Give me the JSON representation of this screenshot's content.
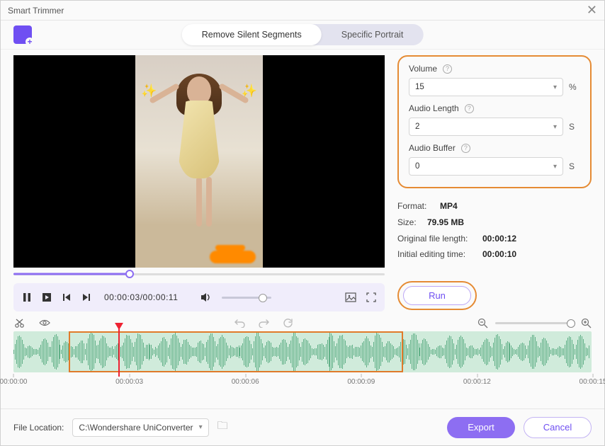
{
  "window": {
    "title": "Smart Trimmer"
  },
  "tabs": {
    "remove_silent": "Remove Silent Segments",
    "specific_portrait": "Specific Portrait"
  },
  "player": {
    "current_time": "00:00:03",
    "total_time": "00:00:11",
    "timecode": "00:00:03/00:00:11"
  },
  "settings": {
    "volume": {
      "label": "Volume",
      "value": "15",
      "unit": "%"
    },
    "audio_length": {
      "label": "Audio Length",
      "value": "2",
      "unit": "S"
    },
    "audio_buffer": {
      "label": "Audio Buffer",
      "value": "0",
      "unit": "S"
    }
  },
  "info": {
    "format": {
      "label": "Format:",
      "value": "MP4"
    },
    "size": {
      "label": "Size:",
      "value": "79.95 MB"
    },
    "orig_len": {
      "label": "Original file length:",
      "value": "00:00:12"
    },
    "init_edit": {
      "label": "Initial editing time:",
      "value": "00:00:10"
    }
  },
  "buttons": {
    "run": "Run",
    "export": "Export",
    "cancel": "Cancel"
  },
  "file_location": {
    "label": "File Location:",
    "path": "C:\\Wondershare UniConverter"
  },
  "ruler": [
    "00:00:00",
    "00:00:03",
    "00:00:06",
    "00:00:09",
    "00:00:12",
    "00:00:15"
  ]
}
